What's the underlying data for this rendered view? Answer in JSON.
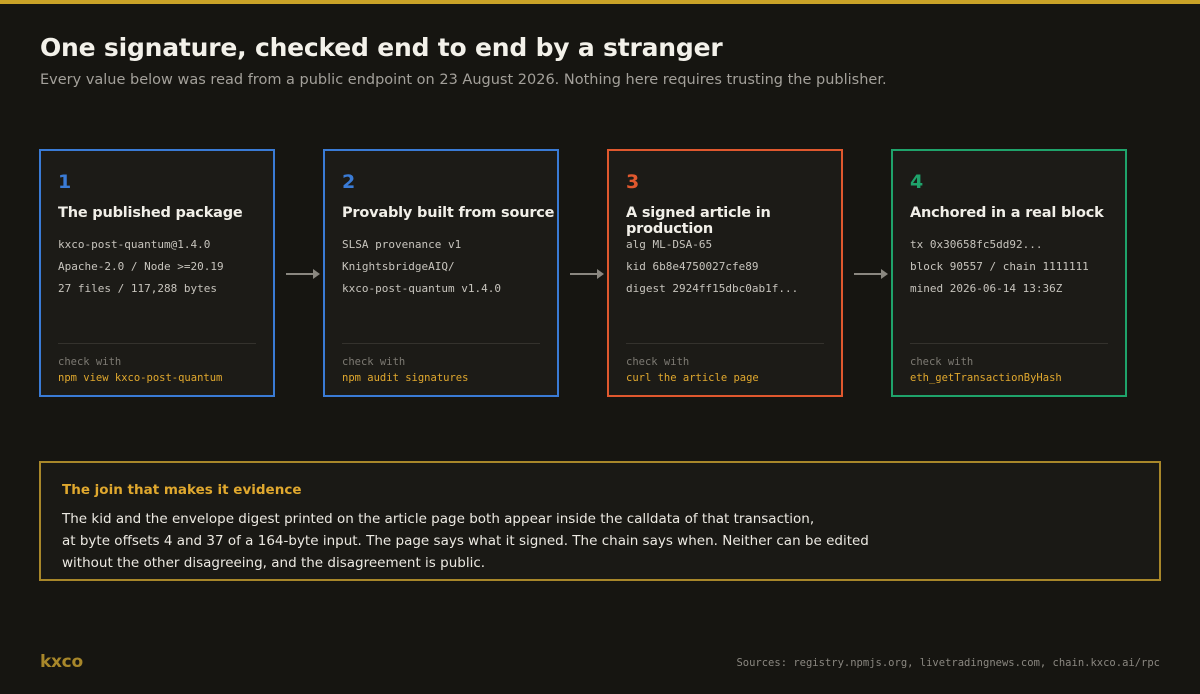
{
  "header": {
    "title": "One signature, checked end to end by a stranger",
    "subtitle": "Every value below was read from a public endpoint on 23 August 2026. Nothing here requires trusting the publisher."
  },
  "colors": {
    "accent": "#c9a227",
    "blue": "#3a7bd5",
    "orange": "#e0582e",
    "green": "#1fa36b",
    "command": "#e0a82e"
  },
  "steps": [
    {
      "number": "1",
      "title": "The published package",
      "color": "#3a7bd5",
      "lines": [
        "kxco-post-quantum@1.4.0",
        "Apache-2.0 / Node >=20.19",
        "27 files / 117,288 bytes"
      ],
      "check_label": "check with",
      "check_command": "npm view kxco-post-quantum"
    },
    {
      "number": "2",
      "title": "Provably built from source",
      "color": "#3a7bd5",
      "lines": [
        "SLSA provenance v1",
        "KnightsbridgeAIQ/",
        "kxco-post-quantum v1.4.0"
      ],
      "check_label": "check with",
      "check_command": "npm audit signatures"
    },
    {
      "number": "3",
      "title": "A signed article in production",
      "color": "#e0582e",
      "lines": [
        "alg ML-DSA-65",
        "kid 6b8e4750027cfe89",
        "digest 2924ff15dbc0ab1f..."
      ],
      "check_label": "check with",
      "check_command": "curl the article page"
    },
    {
      "number": "4",
      "title": "Anchored in a real block",
      "color": "#1fa36b",
      "lines": [
        "tx 0x30658fc5dd92...",
        "block 90557 / chain 1111111",
        "mined 2026-06-14 13:36Z"
      ],
      "check_label": "check with",
      "check_command": "eth_getTransactionByHash"
    }
  ],
  "join": {
    "title": "The join that makes it evidence",
    "lines": [
      "The kid and the envelope digest printed on the article page both appear inside the calldata of that transaction,",
      "at byte offsets 4 and 37 of a 164-byte input. The page says what it signed. The chain says when. Neither can be edited",
      "without the other disagreeing, and the disagreement is public."
    ]
  },
  "footer": {
    "brand": "kxco",
    "sources": "Sources: registry.npmjs.org, livetradingnews.com, chain.kxco.ai/rpc"
  }
}
